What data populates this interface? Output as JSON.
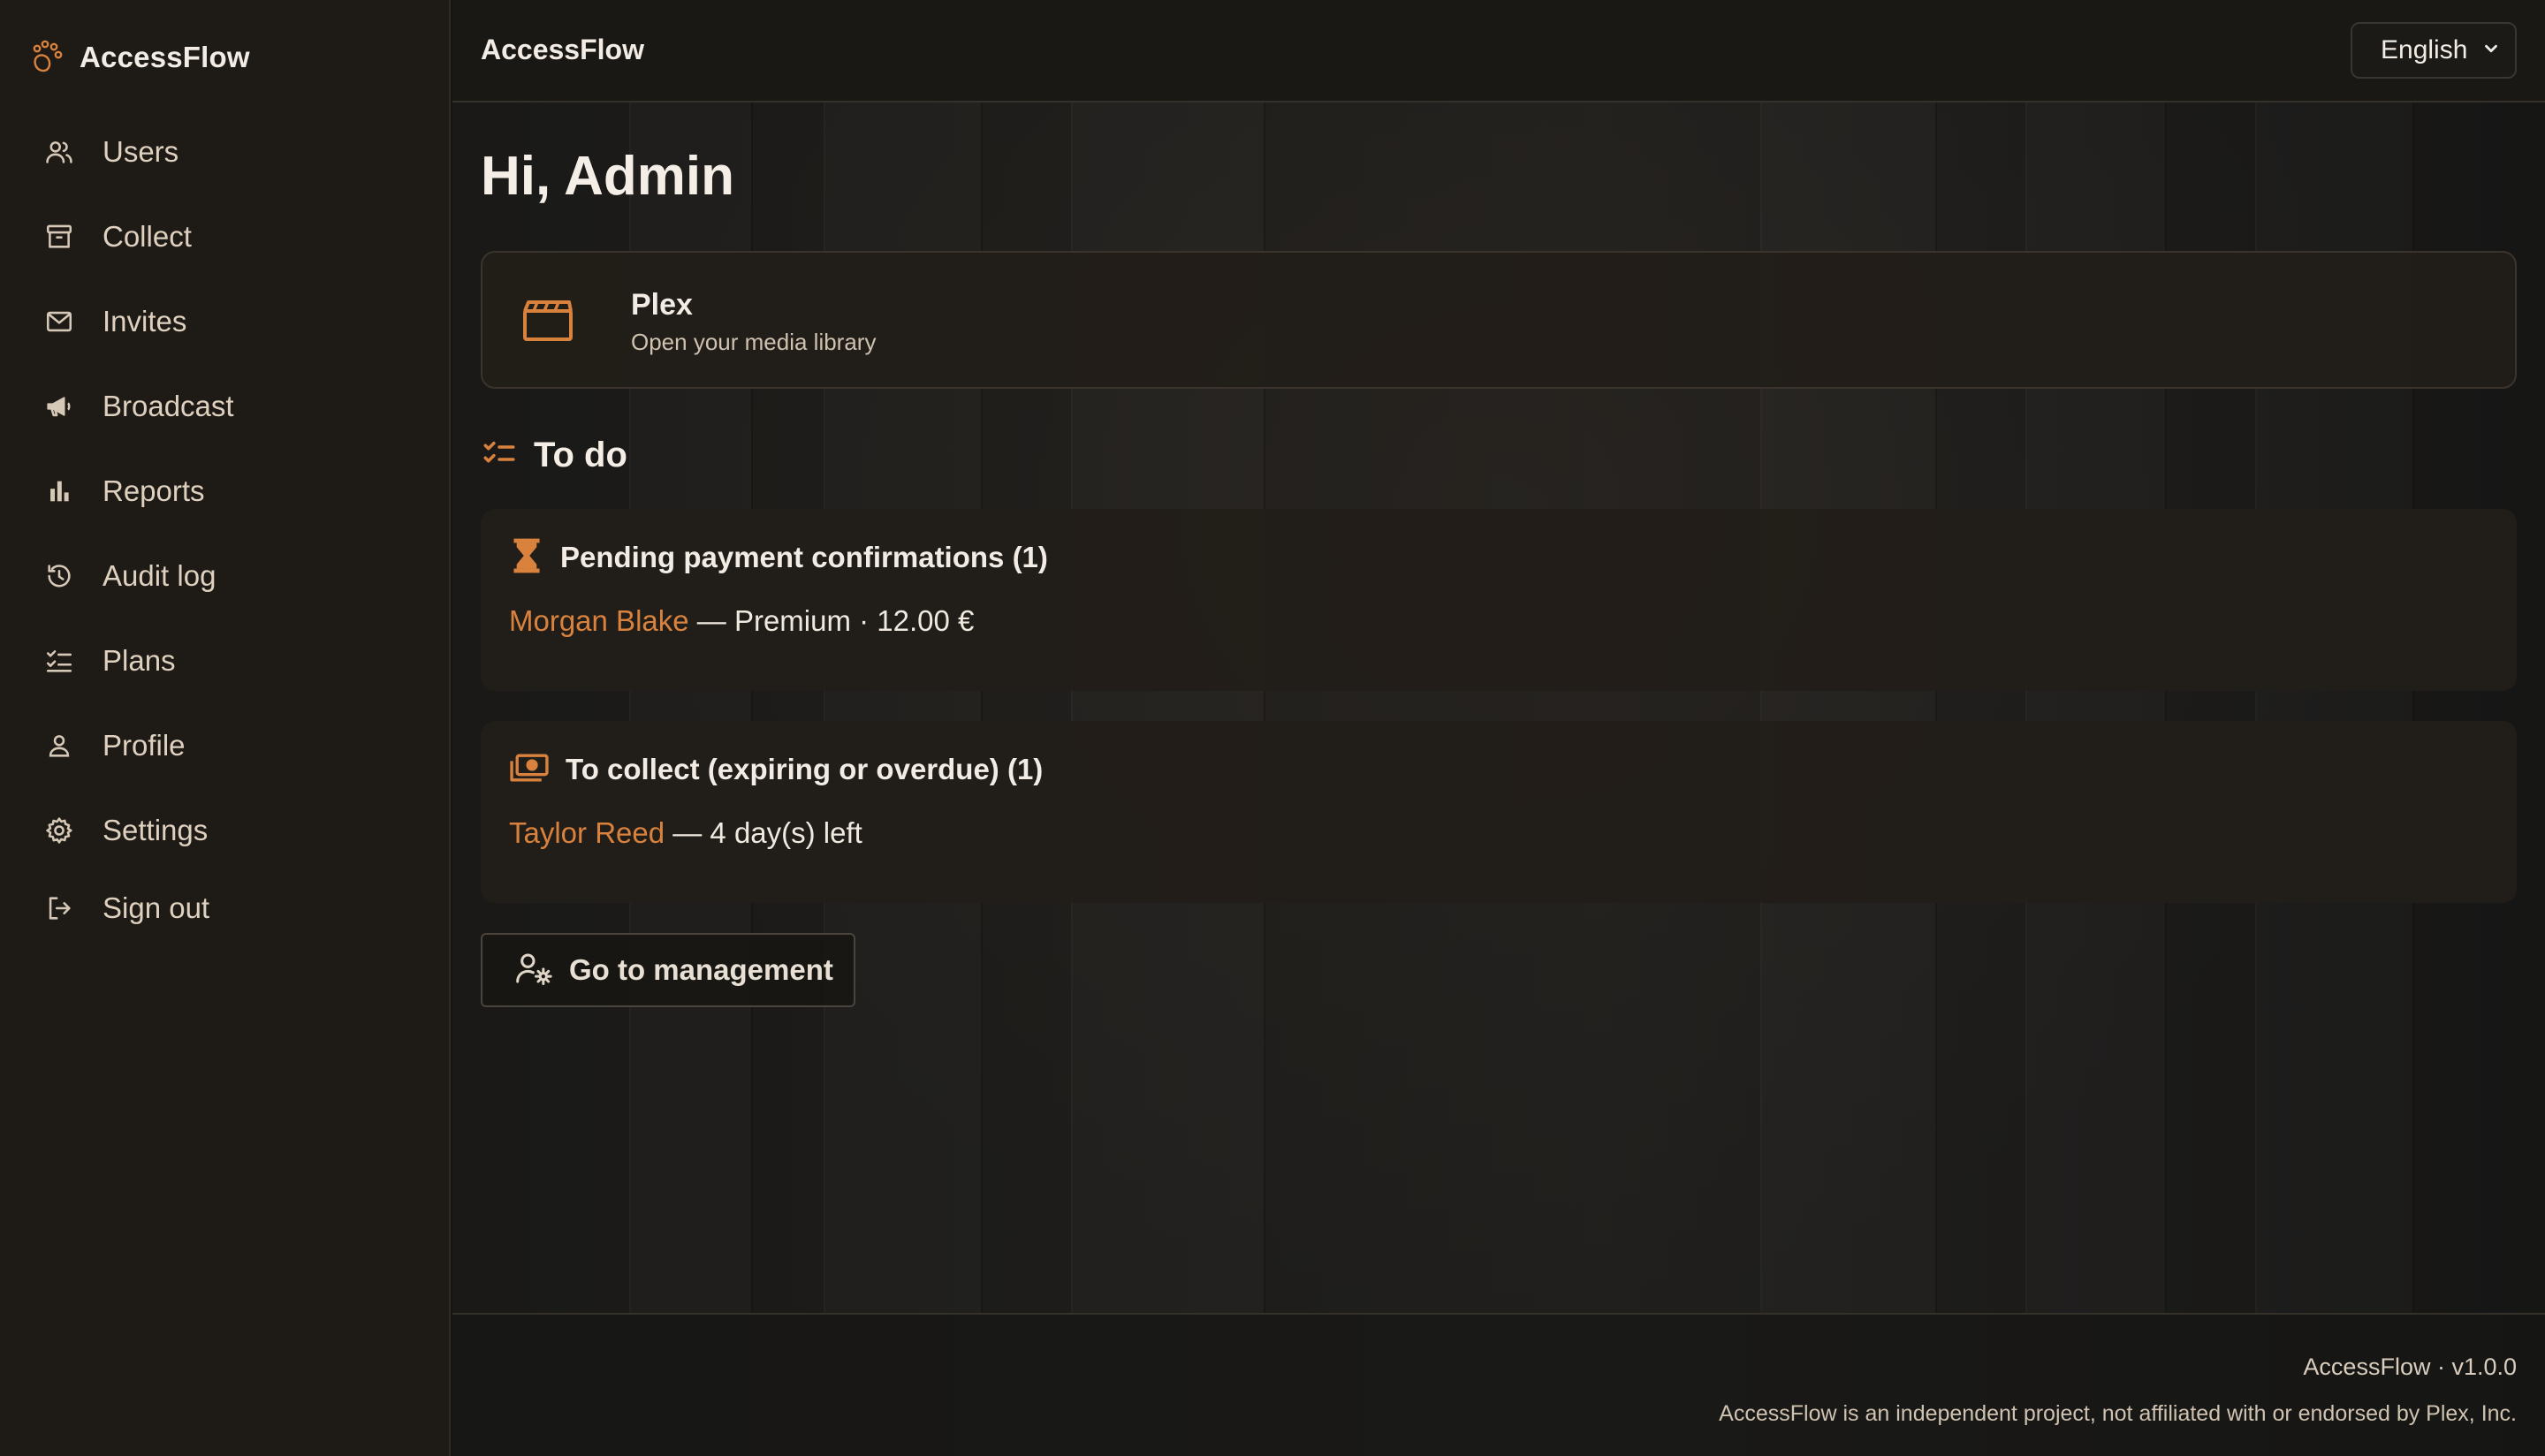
{
  "app": {
    "name": "AccessFlow"
  },
  "sidebar": {
    "items": [
      {
        "label": "Users",
        "icon": "users-icon"
      },
      {
        "label": "Collect",
        "icon": "archive-icon"
      },
      {
        "label": "Invites",
        "icon": "mail-icon"
      },
      {
        "label": "Broadcast",
        "icon": "megaphone-icon"
      },
      {
        "label": "Reports",
        "icon": "bar-chart-icon"
      },
      {
        "label": "Audit log",
        "icon": "history-icon"
      },
      {
        "label": "Plans",
        "icon": "checklist-icon"
      },
      {
        "label": "Profile",
        "icon": "user-icon"
      },
      {
        "label": "Settings",
        "icon": "gear-icon"
      },
      {
        "label": "Sign out",
        "icon": "sign-out-icon"
      }
    ]
  },
  "header": {
    "title": "AccessFlow",
    "language": {
      "selected": "English"
    }
  },
  "main": {
    "greeting": "Hi, Admin",
    "plex": {
      "title": "Plex",
      "subtitle": "Open your media library",
      "icon": "clapperboard-icon"
    },
    "todo": {
      "title": "To do",
      "tasks": [
        {
          "title": "Pending payment confirmations (1)",
          "icon": "hourglass-icon",
          "link": "Morgan Blake",
          "detail": " — Premium · 12.00 €"
        },
        {
          "title": "To collect (expiring or overdue) (1)",
          "icon": "money-icon",
          "link": "Taylor Reed",
          "detail": " — 4 day(s) left"
        }
      ]
    },
    "manage_button": {
      "label": "Go to management",
      "icon": "user-gear-icon"
    }
  },
  "footer": {
    "version": "AccessFlow · v1.0.0",
    "disclaimer": "AccessFlow is an independent project, not affiliated with or endorsed by Plex, Inc."
  },
  "colors": {
    "accent": "#d9823e",
    "sidebar_bg": "#1e1a16",
    "card_bg": "#221d18"
  }
}
